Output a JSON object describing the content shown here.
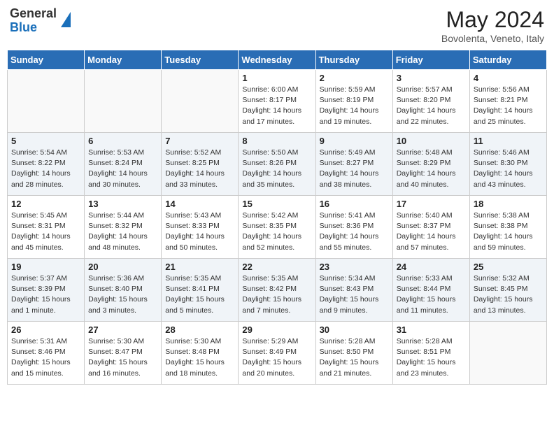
{
  "header": {
    "logo_general": "General",
    "logo_blue": "Blue",
    "month_year": "May 2024",
    "location": "Bovolenta, Veneto, Italy"
  },
  "weekdays": [
    "Sunday",
    "Monday",
    "Tuesday",
    "Wednesday",
    "Thursday",
    "Friday",
    "Saturday"
  ],
  "weeks": [
    [
      {
        "day": "",
        "info": ""
      },
      {
        "day": "",
        "info": ""
      },
      {
        "day": "",
        "info": ""
      },
      {
        "day": "1",
        "info": "Sunrise: 6:00 AM\nSunset: 8:17 PM\nDaylight: 14 hours\nand 17 minutes."
      },
      {
        "day": "2",
        "info": "Sunrise: 5:59 AM\nSunset: 8:19 PM\nDaylight: 14 hours\nand 19 minutes."
      },
      {
        "day": "3",
        "info": "Sunrise: 5:57 AM\nSunset: 8:20 PM\nDaylight: 14 hours\nand 22 minutes."
      },
      {
        "day": "4",
        "info": "Sunrise: 5:56 AM\nSunset: 8:21 PM\nDaylight: 14 hours\nand 25 minutes."
      }
    ],
    [
      {
        "day": "5",
        "info": "Sunrise: 5:54 AM\nSunset: 8:22 PM\nDaylight: 14 hours\nand 28 minutes."
      },
      {
        "day": "6",
        "info": "Sunrise: 5:53 AM\nSunset: 8:24 PM\nDaylight: 14 hours\nand 30 minutes."
      },
      {
        "day": "7",
        "info": "Sunrise: 5:52 AM\nSunset: 8:25 PM\nDaylight: 14 hours\nand 33 minutes."
      },
      {
        "day": "8",
        "info": "Sunrise: 5:50 AM\nSunset: 8:26 PM\nDaylight: 14 hours\nand 35 minutes."
      },
      {
        "day": "9",
        "info": "Sunrise: 5:49 AM\nSunset: 8:27 PM\nDaylight: 14 hours\nand 38 minutes."
      },
      {
        "day": "10",
        "info": "Sunrise: 5:48 AM\nSunset: 8:29 PM\nDaylight: 14 hours\nand 40 minutes."
      },
      {
        "day": "11",
        "info": "Sunrise: 5:46 AM\nSunset: 8:30 PM\nDaylight: 14 hours\nand 43 minutes."
      }
    ],
    [
      {
        "day": "12",
        "info": "Sunrise: 5:45 AM\nSunset: 8:31 PM\nDaylight: 14 hours\nand 45 minutes."
      },
      {
        "day": "13",
        "info": "Sunrise: 5:44 AM\nSunset: 8:32 PM\nDaylight: 14 hours\nand 48 minutes."
      },
      {
        "day": "14",
        "info": "Sunrise: 5:43 AM\nSunset: 8:33 PM\nDaylight: 14 hours\nand 50 minutes."
      },
      {
        "day": "15",
        "info": "Sunrise: 5:42 AM\nSunset: 8:35 PM\nDaylight: 14 hours\nand 52 minutes."
      },
      {
        "day": "16",
        "info": "Sunrise: 5:41 AM\nSunset: 8:36 PM\nDaylight: 14 hours\nand 55 minutes."
      },
      {
        "day": "17",
        "info": "Sunrise: 5:40 AM\nSunset: 8:37 PM\nDaylight: 14 hours\nand 57 minutes."
      },
      {
        "day": "18",
        "info": "Sunrise: 5:38 AM\nSunset: 8:38 PM\nDaylight: 14 hours\nand 59 minutes."
      }
    ],
    [
      {
        "day": "19",
        "info": "Sunrise: 5:37 AM\nSunset: 8:39 PM\nDaylight: 15 hours\nand 1 minute."
      },
      {
        "day": "20",
        "info": "Sunrise: 5:36 AM\nSunset: 8:40 PM\nDaylight: 15 hours\nand 3 minutes."
      },
      {
        "day": "21",
        "info": "Sunrise: 5:35 AM\nSunset: 8:41 PM\nDaylight: 15 hours\nand 5 minutes."
      },
      {
        "day": "22",
        "info": "Sunrise: 5:35 AM\nSunset: 8:42 PM\nDaylight: 15 hours\nand 7 minutes."
      },
      {
        "day": "23",
        "info": "Sunrise: 5:34 AM\nSunset: 8:43 PM\nDaylight: 15 hours\nand 9 minutes."
      },
      {
        "day": "24",
        "info": "Sunrise: 5:33 AM\nSunset: 8:44 PM\nDaylight: 15 hours\nand 11 minutes."
      },
      {
        "day": "25",
        "info": "Sunrise: 5:32 AM\nSunset: 8:45 PM\nDaylight: 15 hours\nand 13 minutes."
      }
    ],
    [
      {
        "day": "26",
        "info": "Sunrise: 5:31 AM\nSunset: 8:46 PM\nDaylight: 15 hours\nand 15 minutes."
      },
      {
        "day": "27",
        "info": "Sunrise: 5:30 AM\nSunset: 8:47 PM\nDaylight: 15 hours\nand 16 minutes."
      },
      {
        "day": "28",
        "info": "Sunrise: 5:30 AM\nSunset: 8:48 PM\nDaylight: 15 hours\nand 18 minutes."
      },
      {
        "day": "29",
        "info": "Sunrise: 5:29 AM\nSunset: 8:49 PM\nDaylight: 15 hours\nand 20 minutes."
      },
      {
        "day": "30",
        "info": "Sunrise: 5:28 AM\nSunset: 8:50 PM\nDaylight: 15 hours\nand 21 minutes."
      },
      {
        "day": "31",
        "info": "Sunrise: 5:28 AM\nSunset: 8:51 PM\nDaylight: 15 hours\nand 23 minutes."
      },
      {
        "day": "",
        "info": ""
      }
    ]
  ]
}
